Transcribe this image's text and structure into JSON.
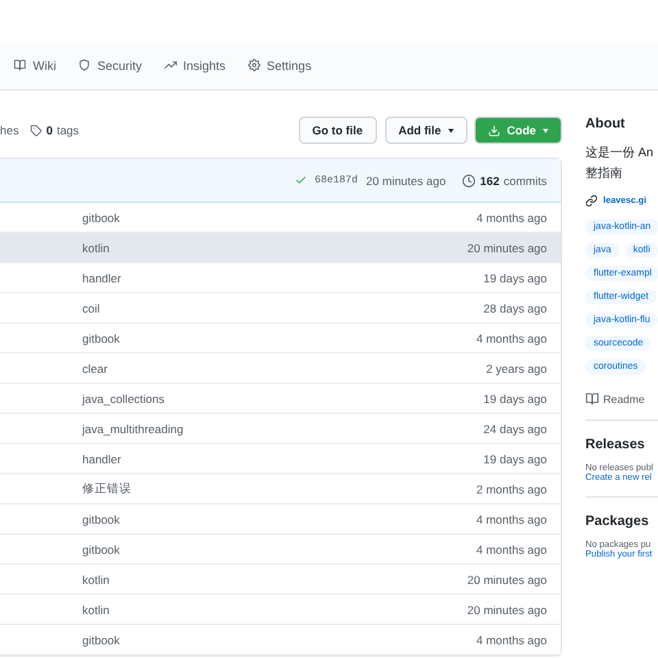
{
  "nav_tabs": [
    {
      "label": "Wiki",
      "selected": false
    },
    {
      "label": "Security",
      "selected": false
    },
    {
      "label": "Insights",
      "selected": false
    },
    {
      "label": "Settings",
      "selected": false
    }
  ],
  "branch_info": {
    "branches": "hes",
    "tags_count": "0",
    "tags_label": "tags"
  },
  "buttons": {
    "go_to_file": "Go to file",
    "add_file": "Add file",
    "code": "Code"
  },
  "latest_commit": {
    "hash": "68e187d",
    "time": "20 minutes ago",
    "commits_count": "162",
    "commits_label": "commits",
    "passed": true
  },
  "files": [
    {
      "message": "gitbook",
      "time": "4 months ago",
      "highlighted": false
    },
    {
      "message": "kotlin",
      "time": "20 minutes ago",
      "highlighted": true
    },
    {
      "message": "handler",
      "time": "19 days ago",
      "highlighted": false
    },
    {
      "message": "coil",
      "time": "28 days ago",
      "highlighted": false
    },
    {
      "message": "gitbook",
      "time": "4 months ago",
      "highlighted": false
    },
    {
      "message": "clear",
      "time": "2 years ago",
      "highlighted": false
    },
    {
      "message": "java_collections",
      "time": "19 days ago",
      "highlighted": false
    },
    {
      "message": "java_multithreading",
      "time": "24 days ago",
      "highlighted": false
    },
    {
      "message": "handler",
      "time": "19 days ago",
      "highlighted": false
    },
    {
      "message": "修正错误",
      "time": "2 months ago",
      "highlighted": false
    },
    {
      "message": "gitbook",
      "time": "4 months ago",
      "highlighted": false
    },
    {
      "message": "gitbook",
      "time": "4 months ago",
      "highlighted": false
    },
    {
      "message": "kotlin",
      "time": "20 minutes ago",
      "highlighted": false
    },
    {
      "message": "kotlin",
      "time": "20 minutes ago",
      "highlighted": false
    },
    {
      "message": "gitbook",
      "time": "4 months ago",
      "highlighted": false
    }
  ],
  "about": {
    "title": "About",
    "description": [
      "这是一份 An",
      "整指南"
    ],
    "link": "leavesc.gi",
    "topics": [
      [
        "java-kotlin-an"
      ],
      [
        "java",
        "kotli"
      ],
      [
        "flutter-exampl"
      ],
      [
        "flutter-widget"
      ],
      [
        "java-kotlin-flu"
      ],
      [
        "sourcecode"
      ],
      [
        "coroutines"
      ]
    ],
    "readme": "Readme"
  },
  "releases": {
    "title": "Releases",
    "note": "No releases publ",
    "link": "Create a new rel"
  },
  "packages": {
    "title": "Packages",
    "note": "No packages pu",
    "link": "Publish your first"
  }
}
